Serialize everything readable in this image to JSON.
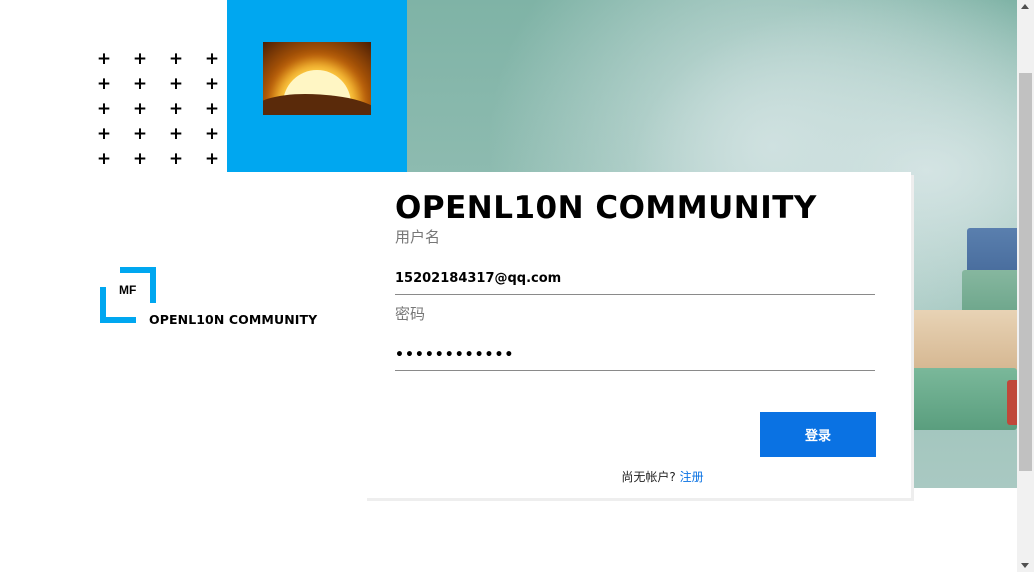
{
  "brand": {
    "logo_initials": "MF",
    "name": "OPENL10N COMMUNITY"
  },
  "decor": {
    "plus_symbol": "+",
    "plus_count": 20,
    "accent_color": "#00a7f0"
  },
  "login": {
    "title": "OPENL10N COMMUNITY",
    "username_label": "用户名",
    "username_value": "15202184317@qq.com",
    "password_label": "密码",
    "password_value": "••••••••••••",
    "submit_label": "登录",
    "no_account_text": "尚无帐户? ",
    "register_link": "注册",
    "button_color": "#0a72e3"
  }
}
